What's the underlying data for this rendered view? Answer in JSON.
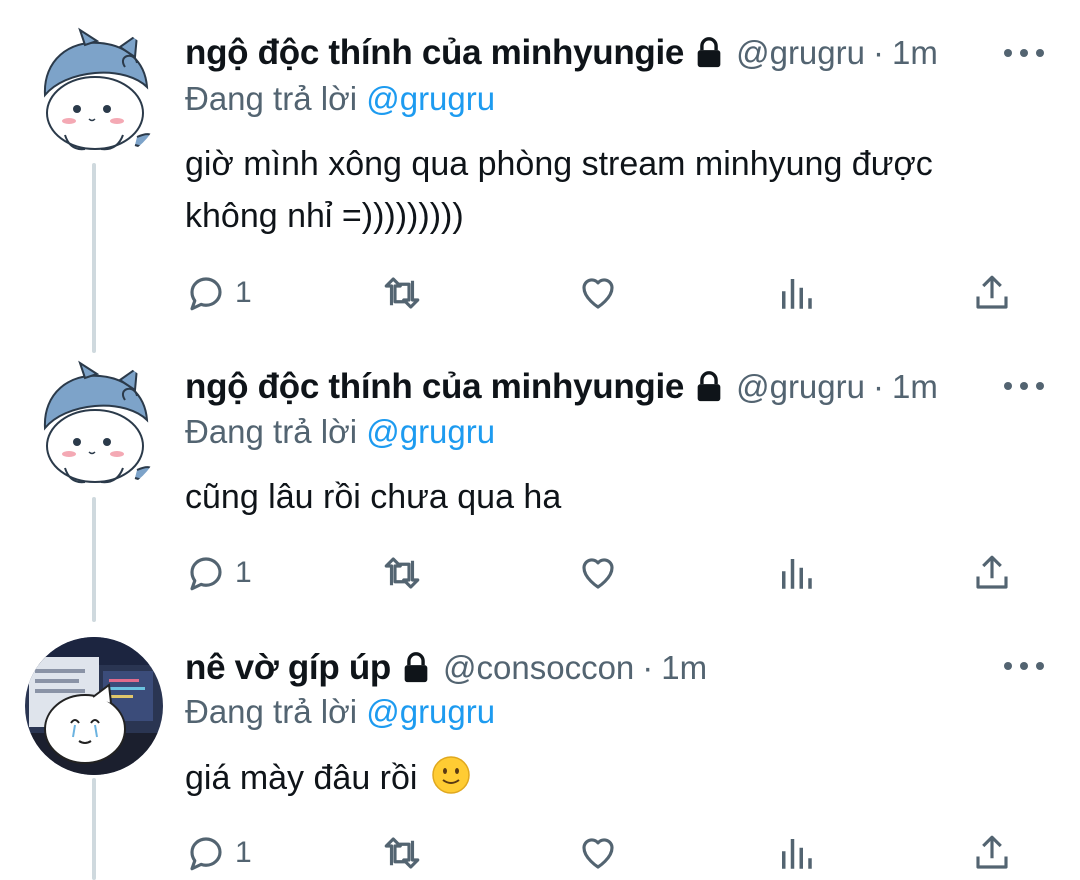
{
  "tweets": [
    {
      "name": "ngộ độc thính của minhyungie",
      "handle": "@grugru",
      "dot": "·",
      "time": "1m",
      "replying_prefix": "Đang trả lời",
      "replying_to": "@grugru",
      "text": "giờ mình xông qua phòng stream minhyung được không nhỉ =)))))))))",
      "reply_count": "1",
      "avatar": "white-cat-hood-avatar"
    },
    {
      "name": "ngộ độc thính của minhyungie",
      "handle": "@grugru",
      "dot": "·",
      "time": "1m",
      "replying_prefix": "Đang trả lời",
      "replying_to": "@grugru",
      "text": "cũng lâu rồi chưa qua ha",
      "reply_count": "1",
      "avatar": "white-cat-hood-avatar"
    },
    {
      "name": "nê vờ gíp úp",
      "handle": "@consoccon",
      "dot": "·",
      "time": "1m",
      "replying_prefix": "Đang trả lời",
      "replying_to": "@grugru",
      "text": "giá mày đâu rồi",
      "emoji": "slightly-smiling-face",
      "reply_count": "1",
      "avatar": "crying-cat-computer-avatar"
    }
  ],
  "colors": {
    "text": "#0f1419",
    "secondary": "#536471",
    "accent": "#1d9bf0",
    "thread_line": "#cfd9de"
  },
  "icons": [
    "lock-icon",
    "more-icon",
    "reply-icon",
    "retweet-icon",
    "like-icon",
    "views-icon",
    "share-icon"
  ]
}
